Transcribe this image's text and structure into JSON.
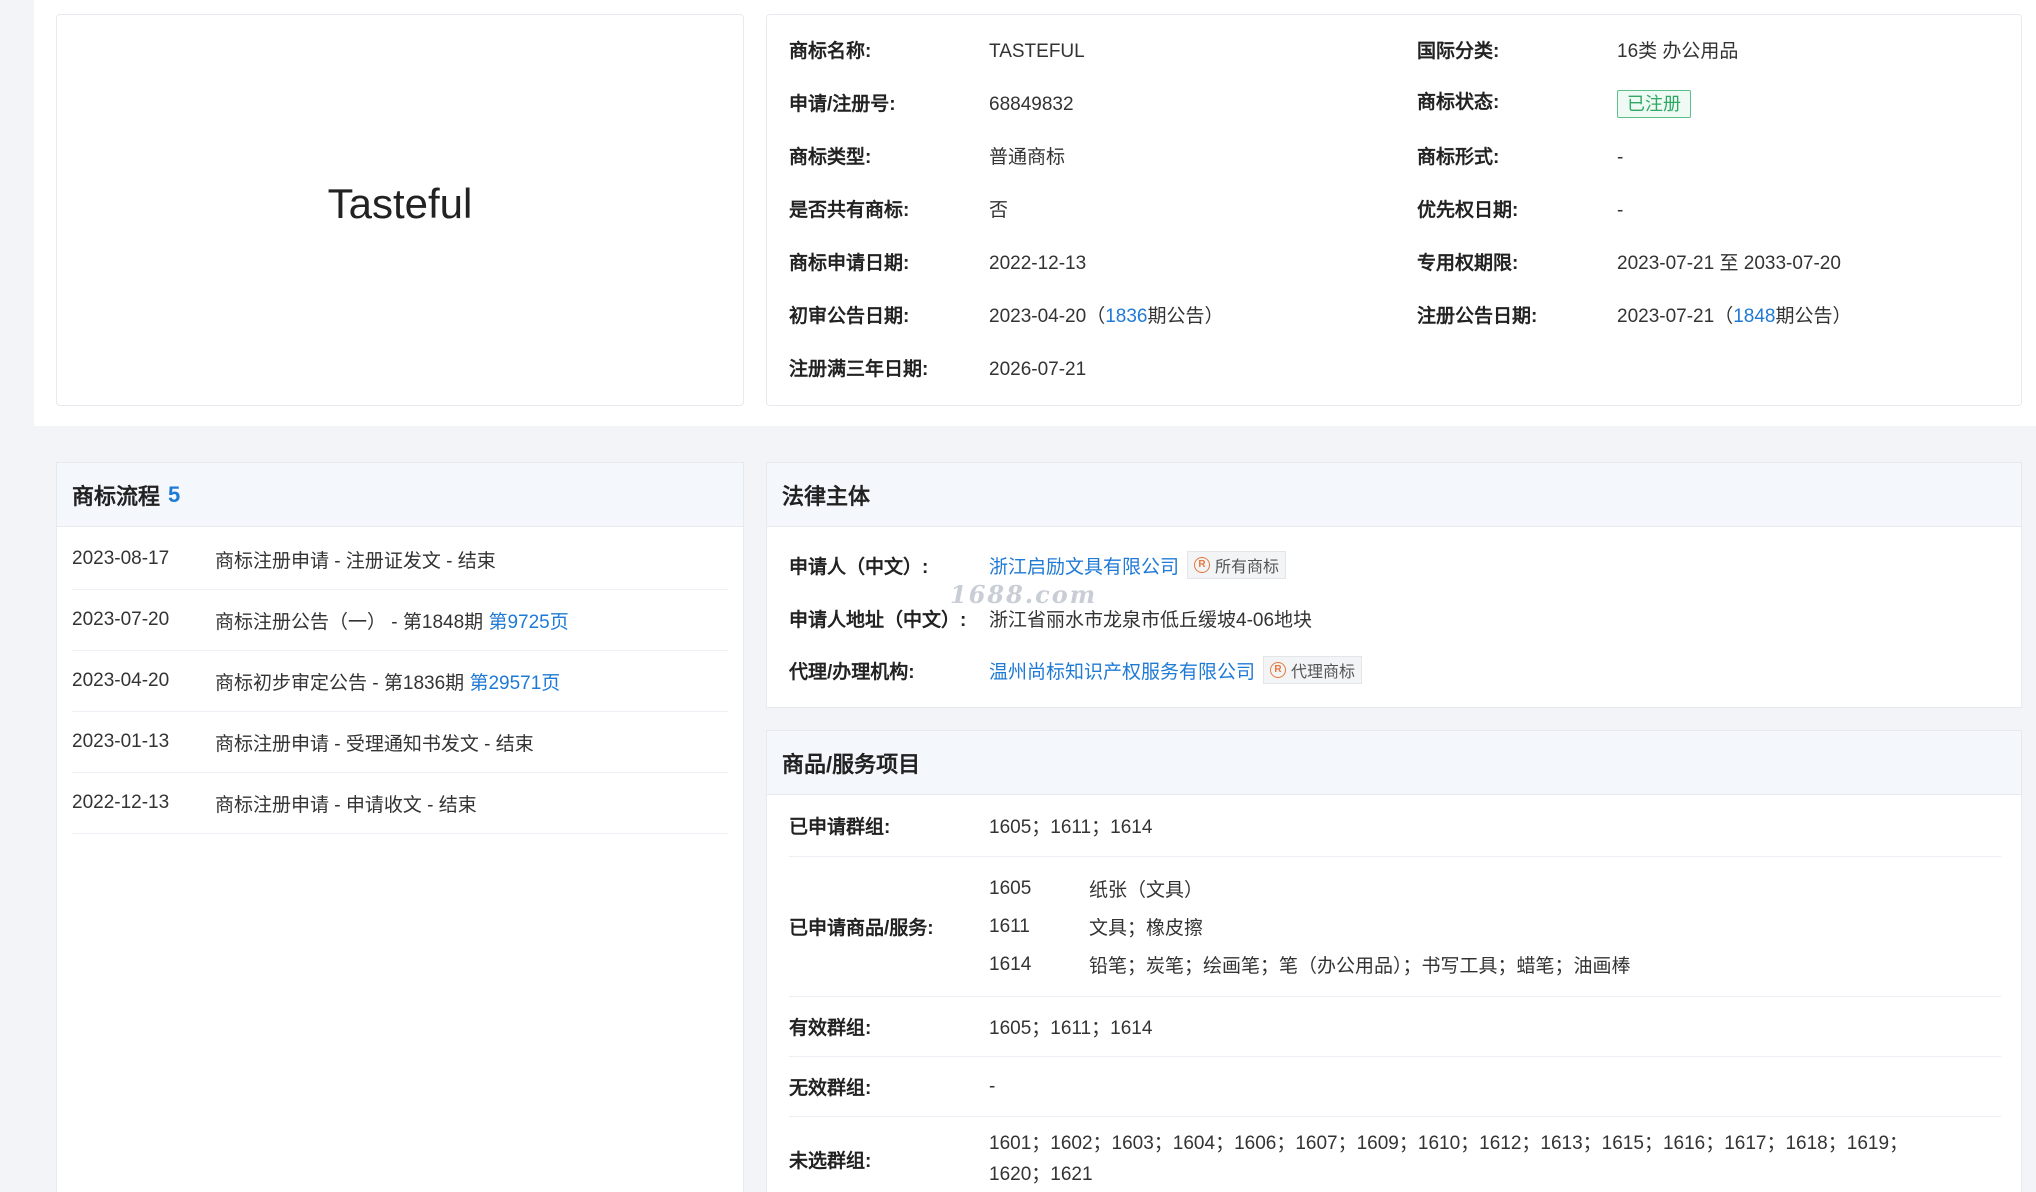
{
  "trademark": {
    "logo_text": "Tasteful",
    "fields_left": [
      {
        "label": "商标名称:",
        "value": "TASTEFUL"
      },
      {
        "label": "申请/注册号:",
        "value": "68849832"
      },
      {
        "label": "商标类型:",
        "value": "普通商标"
      },
      {
        "label": "是否共有商标:",
        "value": "否"
      },
      {
        "label": "商标申请日期:",
        "value": "2022-12-13"
      },
      {
        "label": "初审公告日期:",
        "value_prefix": "2023-04-20（",
        "value_link": "1836",
        "value_suffix": "期公告）"
      },
      {
        "label": "注册满三年日期:",
        "value": "2026-07-21"
      }
    ],
    "fields_right": [
      {
        "label": "国际分类:",
        "value": "16类 办公用品"
      },
      {
        "label": "商标状态:",
        "value": "已注册"
      },
      {
        "label": "商标形式:",
        "value": "-"
      },
      {
        "label": "优先权日期:",
        "value": "-"
      },
      {
        "label": "专用权期限:",
        "value": "2023-07-21 至 2033-07-20"
      },
      {
        "label": "注册公告日期:",
        "value_prefix": "2023-07-21（",
        "value_link": "1848",
        "value_suffix": "期公告）"
      }
    ],
    "status_color": "#2fa865"
  },
  "flow": {
    "title": "商标流程",
    "count": "5",
    "items": [
      {
        "date": "2023-08-17",
        "desc": "商标注册申请 - 注册证发文 - 结束",
        "link": ""
      },
      {
        "date": "2023-07-20",
        "desc": "商标注册公告（一） - 第1848期 ",
        "link": "第9725页"
      },
      {
        "date": "2023-04-20",
        "desc": "商标初步审定公告 - 第1836期 ",
        "link": "第29571页"
      },
      {
        "date": "2023-01-13",
        "desc": "商标注册申请 - 受理通知书发文 - 结束",
        "link": ""
      },
      {
        "date": "2022-12-13",
        "desc": "商标注册申请 - 申请收文 - 结束",
        "link": ""
      }
    ]
  },
  "legal": {
    "title": "法律主体",
    "applicant_label": "申请人（中文）:",
    "applicant_value": "浙江启励文具有限公司",
    "applicant_tag": "所有商标",
    "address_label": "申请人地址（中文）:",
    "address_value": "浙江省丽水市龙泉市低丘缓坡4-06地块",
    "agent_label": "代理/办理机构:",
    "agent_value": "温州尚标知识产权服务有限公司",
    "agent_tag": "代理商标",
    "watermark": "1688.com"
  },
  "goods": {
    "title": "商品/服务项目",
    "applied_groups_label": "已申请群组:",
    "applied_groups_value": "1605；1611；1614",
    "applied_services_label": "已申请商品/服务:",
    "services": [
      {
        "code": "1605",
        "desc": "纸张（文具）"
      },
      {
        "code": "1611",
        "desc": "文具；橡皮擦"
      },
      {
        "code": "1614",
        "desc": "铅笔；炭笔；绘画笔；笔（办公用品）；书写工具；蜡笔；油画棒"
      }
    ],
    "valid_groups_label": "有效群组:",
    "valid_groups_value": "1605；1611；1614",
    "invalid_groups_label": "无效群组:",
    "invalid_groups_value": "-",
    "unselected_groups_label": "未选群组:",
    "unselected_groups_line1": "1601；1602；1603；1604；1606；1607；1609；1610；1612；1613；1615；1616；1617；1618；1619；",
    "unselected_groups_line2": "1620；1621"
  }
}
